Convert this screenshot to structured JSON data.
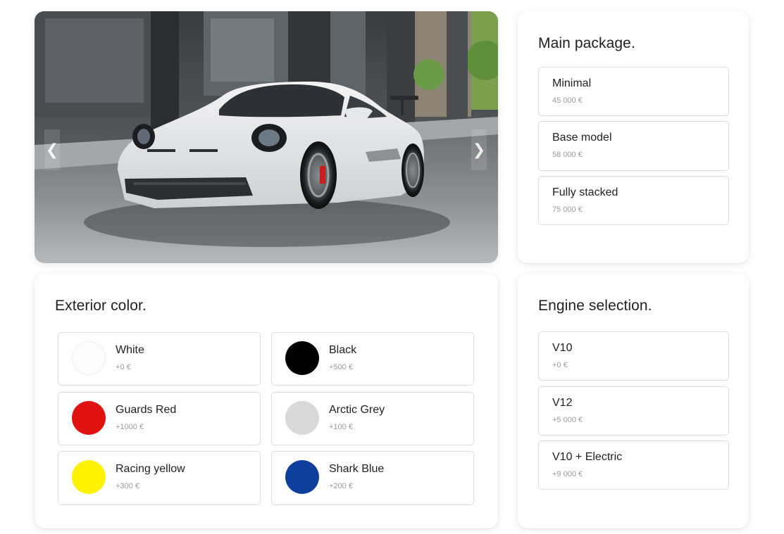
{
  "hero": {
    "prev_arrow": "❮",
    "next_arrow": "❯"
  },
  "main_package": {
    "title": "Main package.",
    "options": [
      {
        "name": "Minimal",
        "price": "45 000 €"
      },
      {
        "name": "Base model",
        "price": "58 000 €"
      },
      {
        "name": "Fully stacked",
        "price": "75 000 €"
      }
    ]
  },
  "exterior_color": {
    "title": "Exterior color.",
    "options": [
      {
        "name": "White",
        "price": "+0 €",
        "color": "#fcfcfc"
      },
      {
        "name": "Black",
        "price": "+500 €",
        "color": "#000000"
      },
      {
        "name": "Guards Red",
        "price": "+1000 €",
        "color": "#e01212"
      },
      {
        "name": "Arctic Grey",
        "price": "+100 €",
        "color": "#d8d8d8"
      },
      {
        "name": "Racing yellow",
        "price": "+300 €",
        "color": "#fff200"
      },
      {
        "name": "Shark Blue",
        "price": "+200 €",
        "color": "#0f3f9c"
      }
    ]
  },
  "engine_selection": {
    "title": "Engine selection.",
    "options": [
      {
        "name": "V10",
        "price": "+0 €"
      },
      {
        "name": "V12",
        "price": "+5 000 €"
      },
      {
        "name": "V10 + Electric",
        "price": "+9 000 €"
      }
    ]
  }
}
